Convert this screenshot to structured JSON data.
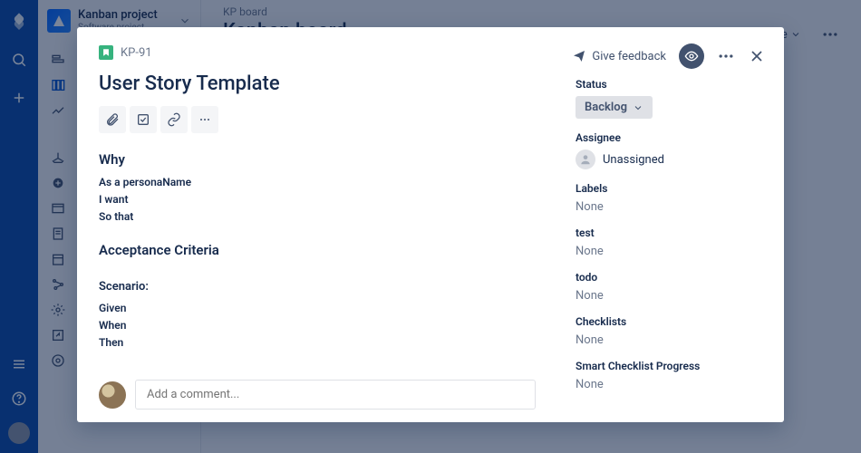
{
  "project": {
    "name": "Kanban project",
    "type": "Software project"
  },
  "board": {
    "breadcrumb": "KP board",
    "title": "Kanban board",
    "release_label": "Release"
  },
  "modal": {
    "issue_key": "KP-91",
    "title": "User Story Template",
    "feedback_label": "Give feedback",
    "description": {
      "why_heading": "Why",
      "why_line1": "As a personaName",
      "why_line2": "I want",
      "why_line3": "So that",
      "ac_heading": "Acceptance Criteria",
      "scenario_heading": "Scenario:",
      "scenario_line1": "Given",
      "scenario_line2": "When",
      "scenario_line3": "Then"
    },
    "comment_placeholder": "Add a comment..."
  },
  "fields": {
    "status": {
      "label": "Status",
      "value": "Backlog"
    },
    "assignee": {
      "label": "Assignee",
      "value": "Unassigned"
    },
    "labels": {
      "label": "Labels",
      "value": "None"
    },
    "test": {
      "label": "test",
      "value": "None"
    },
    "todo": {
      "label": "todo",
      "value": "None"
    },
    "checklists": {
      "label": "Checklists",
      "value": "None"
    },
    "smart_checklist": {
      "label": "Smart Checklist Progress",
      "value": "None"
    }
  }
}
